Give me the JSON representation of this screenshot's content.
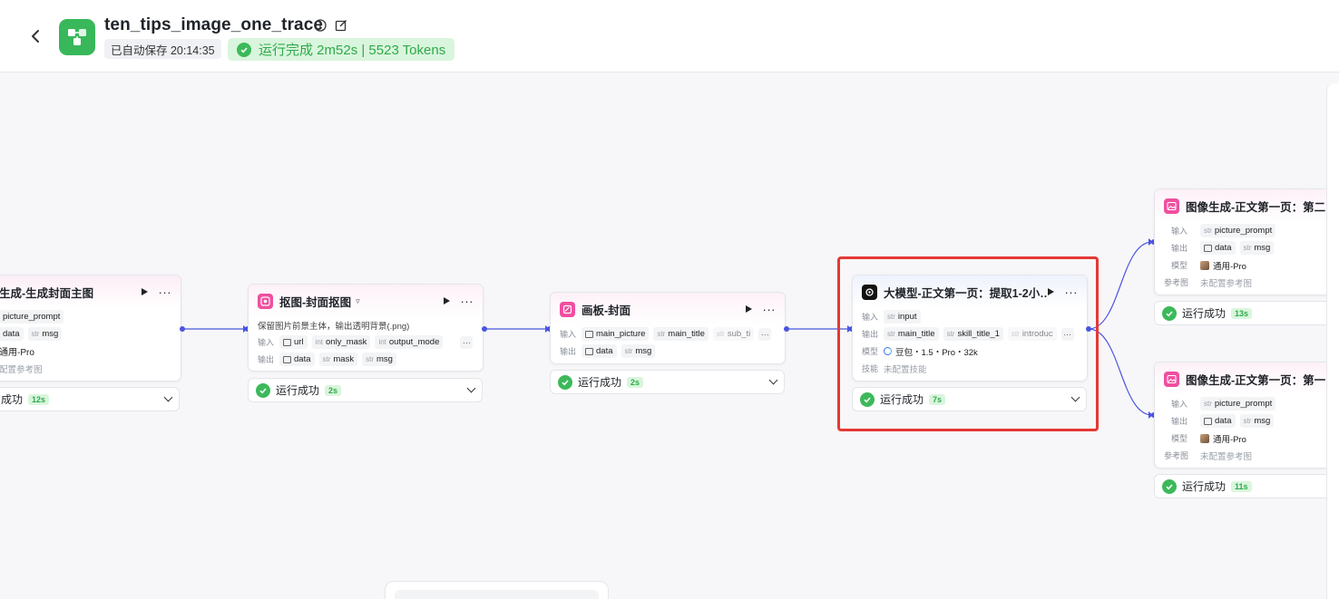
{
  "header": {
    "title": "ten_tips_image_one_trace",
    "autosave": "已自动保存 20:14:35",
    "run_status": "运行完成 2m52s | 5523 Tokens",
    "icons": [
      "back-icon",
      "workflow-icon",
      "info-icon",
      "edit-icon",
      "check-icon"
    ]
  },
  "labels": {
    "input": "输入",
    "output": "输出",
    "model": "模型",
    "skill": "技能",
    "reference": "参考图",
    "success": "运行成功",
    "str": "str",
    "int": "int",
    "more": "···"
  },
  "nodes": {
    "cover_gen": {
      "title": "生成-生成封面主图",
      "in1": "picture_prompt",
      "out1": "data",
      "out2": "msg",
      "model": "通用-Pro",
      "reference_value": "配置参考图",
      "status_label": "成功",
      "duration": "12s"
    },
    "matting": {
      "title": "抠图-封面抠图",
      "desc": "保留图片前景主体，输出透明背景(.png)",
      "in1": "url",
      "in2": "only_mask",
      "in3": "output_mode",
      "out1": "data",
      "out2": "mask",
      "out3": "msg",
      "duration": "2s"
    },
    "canvas": {
      "title": "画板-封面",
      "in1": "main_picture",
      "in2": "main_title",
      "in3": "sub_ti",
      "out1": "data",
      "out2": "msg",
      "duration": "2s"
    },
    "llm": {
      "title": "大模型-正文第一页：提取1-2小…",
      "in1": "input",
      "out1": "main_title",
      "out2": "skill_title_1",
      "out3": "introduc",
      "model": "豆包・1.5・Pro・32k",
      "skill_value": "未配置技能",
      "duration": "7s"
    },
    "img_gen_2": {
      "title": "图像生成-正文第一页：第二张图",
      "in1": "picture_prompt",
      "out1": "data",
      "out2": "msg",
      "model": "通用-Pro",
      "reference_value": "未配置参考图",
      "duration": "13s"
    },
    "img_gen_1": {
      "title": "图像生成-正文第一页：第一张图",
      "in1": "picture_prompt",
      "out1": "data",
      "out2": "msg",
      "model": "通用-Pro",
      "reference_value": "未配置参考图",
      "duration": "11s"
    }
  },
  "colors": {
    "accent_edge": "#4a55e0",
    "success": "#2eaa4a",
    "success_bg": "#daf5dd",
    "highlight": "#e53935",
    "node_icon_pink": "#ef4f9f"
  }
}
